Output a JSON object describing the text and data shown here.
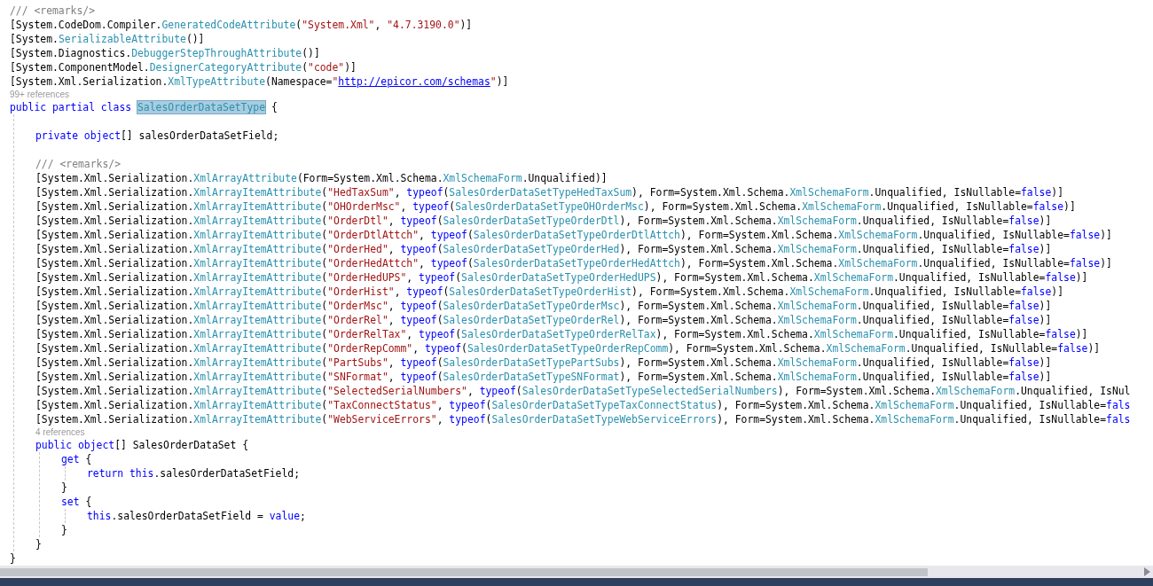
{
  "editor": {
    "lines": [
      {
        "kind": "code",
        "tokens": [
          {
            "kind": "comment",
            "text": "/// <remarks/>"
          }
        ]
      },
      {
        "kind": "code",
        "tokens": [
          {
            "kind": "plain",
            "text": "[System.CodeDom.Compiler."
          },
          {
            "kind": "type",
            "text": "GeneratedCodeAttribute"
          },
          {
            "kind": "plain",
            "text": "("
          },
          {
            "kind": "string",
            "text": "\"System.Xml\""
          },
          {
            "kind": "plain",
            "text": ", "
          },
          {
            "kind": "string",
            "text": "\"4.7.3190.0\""
          },
          {
            "kind": "plain",
            "text": ")]"
          }
        ]
      },
      {
        "kind": "code",
        "tokens": [
          {
            "kind": "plain",
            "text": "[System."
          },
          {
            "kind": "type",
            "text": "SerializableAttribute"
          },
          {
            "kind": "plain",
            "text": "()]"
          }
        ]
      },
      {
        "kind": "code",
        "tokens": [
          {
            "kind": "plain",
            "text": "[System.Diagnostics."
          },
          {
            "kind": "type",
            "text": "DebuggerStepThroughAttribute"
          },
          {
            "kind": "plain",
            "text": "()]"
          }
        ]
      },
      {
        "kind": "code",
        "tokens": [
          {
            "kind": "plain",
            "text": "[System.ComponentModel."
          },
          {
            "kind": "type",
            "text": "DesignerCategoryAttribute"
          },
          {
            "kind": "plain",
            "text": "("
          },
          {
            "kind": "string",
            "text": "\"code\""
          },
          {
            "kind": "plain",
            "text": ")]"
          }
        ]
      },
      {
        "kind": "code",
        "tokens": [
          {
            "kind": "plain",
            "text": "[System.Xml.Serialization."
          },
          {
            "kind": "type",
            "text": "XmlTypeAttribute"
          },
          {
            "kind": "plain",
            "text": "(Namespace="
          },
          {
            "kind": "string",
            "text": "\""
          },
          {
            "kind": "link",
            "text": "http://epicor.com/schemas"
          },
          {
            "kind": "string",
            "text": "\""
          },
          {
            "kind": "plain",
            "text": ")]"
          }
        ]
      },
      {
        "kind": "lens",
        "text": "99+ references"
      },
      {
        "kind": "code",
        "tokens": [
          {
            "kind": "keyword",
            "text": "public partial class "
          },
          {
            "kind": "highlight",
            "text": "SalesOrderDataSetType"
          },
          {
            "kind": "plain",
            "text": " {"
          }
        ],
        "children": [
          {
            "kind": "blank"
          },
          {
            "kind": "code",
            "tokens": [
              {
                "kind": "keyword",
                "text": "private object"
              },
              {
                "kind": "plain",
                "text": "[] salesOrderDataSetField;"
              }
            ]
          },
          {
            "kind": "blank"
          },
          {
            "kind": "code",
            "tokens": [
              {
                "kind": "comment",
                "text": "/// <remarks/>"
              }
            ]
          },
          {
            "kind": "code",
            "tokens": [
              {
                "kind": "plain",
                "text": "[System.Xml.Serialization."
              },
              {
                "kind": "type",
                "text": "XmlArrayAttribute"
              },
              {
                "kind": "plain",
                "text": "(Form=System.Xml.Schema."
              },
              {
                "kind": "type",
                "text": "XmlSchemaForm"
              },
              {
                "kind": "plain",
                "text": ".Unqualified)]"
              }
            ]
          },
          {
            "kind": "code",
            "tokens": [
              {
                "kind": "plain",
                "text": "[System.Xml.Serialization."
              },
              {
                "kind": "type",
                "text": "XmlArrayItemAttribute"
              },
              {
                "kind": "plain",
                "text": "("
              },
              {
                "kind": "string",
                "text": "\"HedTaxSum\""
              },
              {
                "kind": "plain",
                "text": ", "
              },
              {
                "kind": "keyword",
                "text": "typeof"
              },
              {
                "kind": "plain",
                "text": "("
              },
              {
                "kind": "type",
                "text": "SalesOrderDataSetTypeHedTaxSum"
              },
              {
                "kind": "plain",
                "text": "), Form=System.Xml.Schema."
              },
              {
                "kind": "type",
                "text": "XmlSchemaForm"
              },
              {
                "kind": "plain",
                "text": ".Unqualified, IsNullable="
              },
              {
                "kind": "keyword",
                "text": "false"
              },
              {
                "kind": "plain",
                "text": ")]"
              }
            ]
          },
          {
            "kind": "code",
            "tokens": [
              {
                "kind": "plain",
                "text": "[System.Xml.Serialization."
              },
              {
                "kind": "type",
                "text": "XmlArrayItemAttribute"
              },
              {
                "kind": "plain",
                "text": "("
              },
              {
                "kind": "string",
                "text": "\"OHOrderMsc\""
              },
              {
                "kind": "plain",
                "text": ", "
              },
              {
                "kind": "keyword",
                "text": "typeof"
              },
              {
                "kind": "plain",
                "text": "("
              },
              {
                "kind": "type",
                "text": "SalesOrderDataSetTypeOHOrderMsc"
              },
              {
                "kind": "plain",
                "text": "), Form=System.Xml.Schema."
              },
              {
                "kind": "type",
                "text": "XmlSchemaForm"
              },
              {
                "kind": "plain",
                "text": ".Unqualified, IsNullable="
              },
              {
                "kind": "keyword",
                "text": "false"
              },
              {
                "kind": "plain",
                "text": ")]"
              }
            ]
          },
          {
            "kind": "code",
            "tokens": [
              {
                "kind": "plain",
                "text": "[System.Xml.Serialization."
              },
              {
                "kind": "type",
                "text": "XmlArrayItemAttribute"
              },
              {
                "kind": "plain",
                "text": "("
              },
              {
                "kind": "string",
                "text": "\"OrderDtl\""
              },
              {
                "kind": "plain",
                "text": ", "
              },
              {
                "kind": "keyword",
                "text": "typeof"
              },
              {
                "kind": "plain",
                "text": "("
              },
              {
                "kind": "type",
                "text": "SalesOrderDataSetTypeOrderDtl"
              },
              {
                "kind": "plain",
                "text": "), Form=System.Xml.Schema."
              },
              {
                "kind": "type",
                "text": "XmlSchemaForm"
              },
              {
                "kind": "plain",
                "text": ".Unqualified, IsNullable="
              },
              {
                "kind": "keyword",
                "text": "false"
              },
              {
                "kind": "plain",
                "text": ")]"
              }
            ]
          },
          {
            "kind": "code",
            "tokens": [
              {
                "kind": "plain",
                "text": "[System.Xml.Serialization."
              },
              {
                "kind": "type",
                "text": "XmlArrayItemAttribute"
              },
              {
                "kind": "plain",
                "text": "("
              },
              {
                "kind": "string",
                "text": "\"OrderDtlAttch\""
              },
              {
                "kind": "plain",
                "text": ", "
              },
              {
                "kind": "keyword",
                "text": "typeof"
              },
              {
                "kind": "plain",
                "text": "("
              },
              {
                "kind": "type",
                "text": "SalesOrderDataSetTypeOrderDtlAttch"
              },
              {
                "kind": "plain",
                "text": "), Form=System.Xml.Schema."
              },
              {
                "kind": "type",
                "text": "XmlSchemaForm"
              },
              {
                "kind": "plain",
                "text": ".Unqualified, IsNullable="
              },
              {
                "kind": "keyword",
                "text": "false"
              },
              {
                "kind": "plain",
                "text": ")]"
              }
            ]
          },
          {
            "kind": "code",
            "tokens": [
              {
                "kind": "plain",
                "text": "[System.Xml.Serialization."
              },
              {
                "kind": "type",
                "text": "XmlArrayItemAttribute"
              },
              {
                "kind": "plain",
                "text": "("
              },
              {
                "kind": "string",
                "text": "\"OrderHed\""
              },
              {
                "kind": "plain",
                "text": ", "
              },
              {
                "kind": "keyword",
                "text": "typeof"
              },
              {
                "kind": "plain",
                "text": "("
              },
              {
                "kind": "type",
                "text": "SalesOrderDataSetTypeOrderHed"
              },
              {
                "kind": "plain",
                "text": "), Form=System.Xml.Schema."
              },
              {
                "kind": "type",
                "text": "XmlSchemaForm"
              },
              {
                "kind": "plain",
                "text": ".Unqualified, IsNullable="
              },
              {
                "kind": "keyword",
                "text": "false"
              },
              {
                "kind": "plain",
                "text": ")]"
              }
            ]
          },
          {
            "kind": "code",
            "tokens": [
              {
                "kind": "plain",
                "text": "[System.Xml.Serialization."
              },
              {
                "kind": "type",
                "text": "XmlArrayItemAttribute"
              },
              {
                "kind": "plain",
                "text": "("
              },
              {
                "kind": "string",
                "text": "\"OrderHedAttch\""
              },
              {
                "kind": "plain",
                "text": ", "
              },
              {
                "kind": "keyword",
                "text": "typeof"
              },
              {
                "kind": "plain",
                "text": "("
              },
              {
                "kind": "type",
                "text": "SalesOrderDataSetTypeOrderHedAttch"
              },
              {
                "kind": "plain",
                "text": "), Form=System.Xml.Schema."
              },
              {
                "kind": "type",
                "text": "XmlSchemaForm"
              },
              {
                "kind": "plain",
                "text": ".Unqualified, IsNullable="
              },
              {
                "kind": "keyword",
                "text": "false"
              },
              {
                "kind": "plain",
                "text": ")]"
              }
            ]
          },
          {
            "kind": "code",
            "tokens": [
              {
                "kind": "plain",
                "text": "[System.Xml.Serialization."
              },
              {
                "kind": "type",
                "text": "XmlArrayItemAttribute"
              },
              {
                "kind": "plain",
                "text": "("
              },
              {
                "kind": "string",
                "text": "\"OrderHedUPS\""
              },
              {
                "kind": "plain",
                "text": ", "
              },
              {
                "kind": "keyword",
                "text": "typeof"
              },
              {
                "kind": "plain",
                "text": "("
              },
              {
                "kind": "type",
                "text": "SalesOrderDataSetTypeOrderHedUPS"
              },
              {
                "kind": "plain",
                "text": "), Form=System.Xml.Schema."
              },
              {
                "kind": "type",
                "text": "XmlSchemaForm"
              },
              {
                "kind": "plain",
                "text": ".Unqualified, IsNullable="
              },
              {
                "kind": "keyword",
                "text": "false"
              },
              {
                "kind": "plain",
                "text": ")]"
              }
            ]
          },
          {
            "kind": "code",
            "tokens": [
              {
                "kind": "plain",
                "text": "[System.Xml.Serialization."
              },
              {
                "kind": "type",
                "text": "XmlArrayItemAttribute"
              },
              {
                "kind": "plain",
                "text": "("
              },
              {
                "kind": "string",
                "text": "\"OrderHist\""
              },
              {
                "kind": "plain",
                "text": ", "
              },
              {
                "kind": "keyword",
                "text": "typeof"
              },
              {
                "kind": "plain",
                "text": "("
              },
              {
                "kind": "type",
                "text": "SalesOrderDataSetTypeOrderHist"
              },
              {
                "kind": "plain",
                "text": "), Form=System.Xml.Schema."
              },
              {
                "kind": "type",
                "text": "XmlSchemaForm"
              },
              {
                "kind": "plain",
                "text": ".Unqualified, IsNullable="
              },
              {
                "kind": "keyword",
                "text": "false"
              },
              {
                "kind": "plain",
                "text": ")]"
              }
            ]
          },
          {
            "kind": "code",
            "tokens": [
              {
                "kind": "plain",
                "text": "[System.Xml.Serialization."
              },
              {
                "kind": "type",
                "text": "XmlArrayItemAttribute"
              },
              {
                "kind": "plain",
                "text": "("
              },
              {
                "kind": "string",
                "text": "\"OrderMsc\""
              },
              {
                "kind": "plain",
                "text": ", "
              },
              {
                "kind": "keyword",
                "text": "typeof"
              },
              {
                "kind": "plain",
                "text": "("
              },
              {
                "kind": "type",
                "text": "SalesOrderDataSetTypeOrderMsc"
              },
              {
                "kind": "plain",
                "text": "), Form=System.Xml.Schema."
              },
              {
                "kind": "type",
                "text": "XmlSchemaForm"
              },
              {
                "kind": "plain",
                "text": ".Unqualified, IsNullable="
              },
              {
                "kind": "keyword",
                "text": "false"
              },
              {
                "kind": "plain",
                "text": ")]"
              }
            ]
          },
          {
            "kind": "code",
            "tokens": [
              {
                "kind": "plain",
                "text": "[System.Xml.Serialization."
              },
              {
                "kind": "type",
                "text": "XmlArrayItemAttribute"
              },
              {
                "kind": "plain",
                "text": "("
              },
              {
                "kind": "string",
                "text": "\"OrderRel\""
              },
              {
                "kind": "plain",
                "text": ", "
              },
              {
                "kind": "keyword",
                "text": "typeof"
              },
              {
                "kind": "plain",
                "text": "("
              },
              {
                "kind": "type",
                "text": "SalesOrderDataSetTypeOrderRel"
              },
              {
                "kind": "plain",
                "text": "), Form=System.Xml.Schema."
              },
              {
                "kind": "type",
                "text": "XmlSchemaForm"
              },
              {
                "kind": "plain",
                "text": ".Unqualified, IsNullable="
              },
              {
                "kind": "keyword",
                "text": "false"
              },
              {
                "kind": "plain",
                "text": ")]"
              }
            ]
          },
          {
            "kind": "code",
            "tokens": [
              {
                "kind": "plain",
                "text": "[System.Xml.Serialization."
              },
              {
                "kind": "type",
                "text": "XmlArrayItemAttribute"
              },
              {
                "kind": "plain",
                "text": "("
              },
              {
                "kind": "string",
                "text": "\"OrderRelTax\""
              },
              {
                "kind": "plain",
                "text": ", "
              },
              {
                "kind": "keyword",
                "text": "typeof"
              },
              {
                "kind": "plain",
                "text": "("
              },
              {
                "kind": "type",
                "text": "SalesOrderDataSetTypeOrderRelTax"
              },
              {
                "kind": "plain",
                "text": "), Form=System.Xml.Schema."
              },
              {
                "kind": "type",
                "text": "XmlSchemaForm"
              },
              {
                "kind": "plain",
                "text": ".Unqualified, IsNullable="
              },
              {
                "kind": "keyword",
                "text": "false"
              },
              {
                "kind": "plain",
                "text": ")]"
              }
            ]
          },
          {
            "kind": "code",
            "tokens": [
              {
                "kind": "plain",
                "text": "[System.Xml.Serialization."
              },
              {
                "kind": "type",
                "text": "XmlArrayItemAttribute"
              },
              {
                "kind": "plain",
                "text": "("
              },
              {
                "kind": "string",
                "text": "\"OrderRepComm\""
              },
              {
                "kind": "plain",
                "text": ", "
              },
              {
                "kind": "keyword",
                "text": "typeof"
              },
              {
                "kind": "plain",
                "text": "("
              },
              {
                "kind": "type",
                "text": "SalesOrderDataSetTypeOrderRepComm"
              },
              {
                "kind": "plain",
                "text": "), Form=System.Xml.Schema."
              },
              {
                "kind": "type",
                "text": "XmlSchemaForm"
              },
              {
                "kind": "plain",
                "text": ".Unqualified, IsNullable="
              },
              {
                "kind": "keyword",
                "text": "false"
              },
              {
                "kind": "plain",
                "text": ")]"
              }
            ]
          },
          {
            "kind": "code",
            "tokens": [
              {
                "kind": "plain",
                "text": "[System.Xml.Serialization."
              },
              {
                "kind": "type",
                "text": "XmlArrayItemAttribute"
              },
              {
                "kind": "plain",
                "text": "("
              },
              {
                "kind": "string",
                "text": "\"PartSubs\""
              },
              {
                "kind": "plain",
                "text": ", "
              },
              {
                "kind": "keyword",
                "text": "typeof"
              },
              {
                "kind": "plain",
                "text": "("
              },
              {
                "kind": "type",
                "text": "SalesOrderDataSetTypePartSubs"
              },
              {
                "kind": "plain",
                "text": "), Form=System.Xml.Schema."
              },
              {
                "kind": "type",
                "text": "XmlSchemaForm"
              },
              {
                "kind": "plain",
                "text": ".Unqualified, IsNullable="
              },
              {
                "kind": "keyword",
                "text": "false"
              },
              {
                "kind": "plain",
                "text": ")]"
              }
            ]
          },
          {
            "kind": "code",
            "tokens": [
              {
                "kind": "plain",
                "text": "[System.Xml.Serialization."
              },
              {
                "kind": "type",
                "text": "XmlArrayItemAttribute"
              },
              {
                "kind": "plain",
                "text": "("
              },
              {
                "kind": "string",
                "text": "\"SNFormat\""
              },
              {
                "kind": "plain",
                "text": ", "
              },
              {
                "kind": "keyword",
                "text": "typeof"
              },
              {
                "kind": "plain",
                "text": "("
              },
              {
                "kind": "type",
                "text": "SalesOrderDataSetTypeSNFormat"
              },
              {
                "kind": "plain",
                "text": "), Form=System.Xml.Schema."
              },
              {
                "kind": "type",
                "text": "XmlSchemaForm"
              },
              {
                "kind": "plain",
                "text": ".Unqualified, IsNullable="
              },
              {
                "kind": "keyword",
                "text": "false"
              },
              {
                "kind": "plain",
                "text": ")]"
              }
            ]
          },
          {
            "kind": "code",
            "tokens": [
              {
                "kind": "plain",
                "text": "[System.Xml.Serialization."
              },
              {
                "kind": "type",
                "text": "XmlArrayItemAttribute"
              },
              {
                "kind": "plain",
                "text": "("
              },
              {
                "kind": "string",
                "text": "\"SelectedSerialNumbers\""
              },
              {
                "kind": "plain",
                "text": ", "
              },
              {
                "kind": "keyword",
                "text": "typeof"
              },
              {
                "kind": "plain",
                "text": "("
              },
              {
                "kind": "type",
                "text": "SalesOrderDataSetTypeSelectedSerialNumbers"
              },
              {
                "kind": "plain",
                "text": "), Form=System.Xml.Schema."
              },
              {
                "kind": "type",
                "text": "XmlSchemaForm"
              },
              {
                "kind": "plain",
                "text": ".Unqualified, IsNul"
              }
            ]
          },
          {
            "kind": "code",
            "tokens": [
              {
                "kind": "plain",
                "text": "[System.Xml.Serialization."
              },
              {
                "kind": "type",
                "text": "XmlArrayItemAttribute"
              },
              {
                "kind": "plain",
                "text": "("
              },
              {
                "kind": "string",
                "text": "\"TaxConnectStatus\""
              },
              {
                "kind": "plain",
                "text": ", "
              },
              {
                "kind": "keyword",
                "text": "typeof"
              },
              {
                "kind": "plain",
                "text": "("
              },
              {
                "kind": "type",
                "text": "SalesOrderDataSetTypeTaxConnectStatus"
              },
              {
                "kind": "plain",
                "text": "), Form=System.Xml.Schema."
              },
              {
                "kind": "type",
                "text": "XmlSchemaForm"
              },
              {
                "kind": "plain",
                "text": ".Unqualified, IsNullable="
              },
              {
                "kind": "keyword",
                "text": "fals"
              }
            ]
          },
          {
            "kind": "code",
            "tokens": [
              {
                "kind": "plain",
                "text": "[System.Xml.Serialization."
              },
              {
                "kind": "type",
                "text": "XmlArrayItemAttribute"
              },
              {
                "kind": "plain",
                "text": "("
              },
              {
                "kind": "string",
                "text": "\"WebServiceErrors\""
              },
              {
                "kind": "plain",
                "text": ", "
              },
              {
                "kind": "keyword",
                "text": "typeof"
              },
              {
                "kind": "plain",
                "text": "("
              },
              {
                "kind": "type",
                "text": "SalesOrderDataSetTypeWebServiceErrors"
              },
              {
                "kind": "plain",
                "text": "), Form=System.Xml.Schema."
              },
              {
                "kind": "type",
                "text": "XmlSchemaForm"
              },
              {
                "kind": "plain",
                "text": ".Unqualified, IsNullable="
              },
              {
                "kind": "keyword",
                "text": "fals"
              }
            ]
          },
          {
            "kind": "lens",
            "text": "4 references"
          },
          {
            "kind": "code",
            "tokens": [
              {
                "kind": "keyword",
                "text": "public object"
              },
              {
                "kind": "plain",
                "text": "[] SalesOrderDataSet {"
              }
            ],
            "children": [
              {
                "kind": "code",
                "tokens": [
                  {
                    "kind": "keyword",
                    "text": "get"
                  },
                  {
                    "kind": "plain",
                    "text": " {"
                  }
                ],
                "children": [
                  {
                    "kind": "code",
                    "tokens": [
                      {
                        "kind": "keyword",
                        "text": "return this"
                      },
                      {
                        "kind": "plain",
                        "text": ".salesOrderDataSetField;"
                      }
                    ]
                  }
                ]
              },
              {
                "kind": "code",
                "tokens": [
                  {
                    "kind": "plain",
                    "text": "}"
                  }
                ]
              },
              {
                "kind": "code",
                "tokens": [
                  {
                    "kind": "keyword",
                    "text": "set"
                  },
                  {
                    "kind": "plain",
                    "text": " {"
                  }
                ],
                "children": [
                  {
                    "kind": "code",
                    "tokens": [
                      {
                        "kind": "keyword",
                        "text": "this"
                      },
                      {
                        "kind": "plain",
                        "text": ".salesOrderDataSetField = "
                      },
                      {
                        "kind": "keyword",
                        "text": "value"
                      },
                      {
                        "kind": "plain",
                        "text": ";"
                      }
                    ]
                  }
                ]
              },
              {
                "kind": "code",
                "tokens": [
                  {
                    "kind": "plain",
                    "text": "}"
                  }
                ]
              }
            ]
          },
          {
            "kind": "code",
            "tokens": [
              {
                "kind": "plain",
                "text": "}"
              }
            ]
          }
        ]
      },
      {
        "kind": "code",
        "tokens": [
          {
            "kind": "plain",
            "text": "}"
          }
        ]
      }
    ]
  }
}
